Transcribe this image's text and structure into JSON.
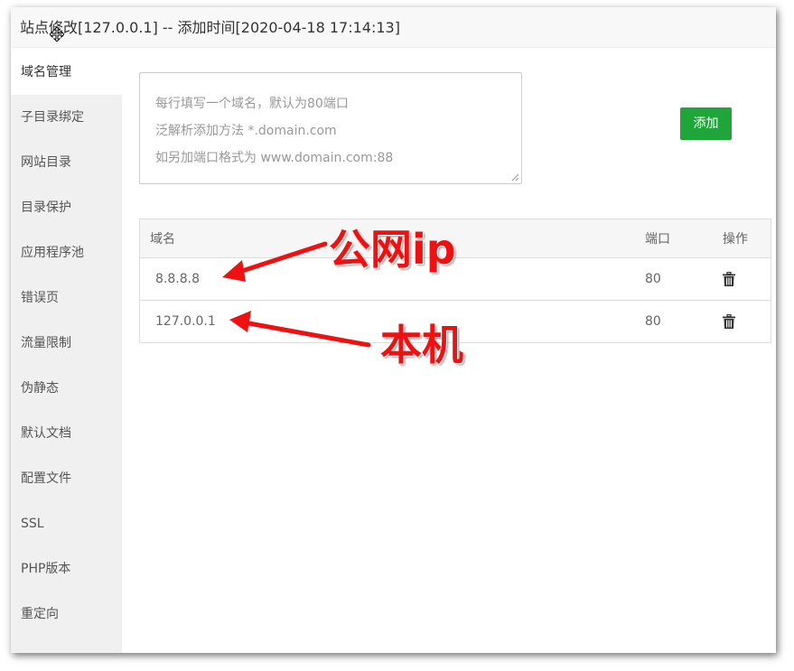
{
  "dialog": {
    "title": "站点修改[127.0.0.1] -- 添加时间[2020-04-18 17:14:13]"
  },
  "sidebar": {
    "items": [
      {
        "label": "域名管理"
      },
      {
        "label": "子目录绑定"
      },
      {
        "label": "网站目录"
      },
      {
        "label": "目录保护"
      },
      {
        "label": "应用程序池"
      },
      {
        "label": "错误页"
      },
      {
        "label": "流量限制"
      },
      {
        "label": "伪静态"
      },
      {
        "label": "默认文档"
      },
      {
        "label": "配置文件"
      },
      {
        "label": "SSL"
      },
      {
        "label": "PHP版本"
      },
      {
        "label": "重定向"
      }
    ],
    "active_index": 0
  },
  "domain_input": {
    "value": "",
    "placeholder_lines": [
      "每行填写一个域名，默认为80端口",
      "泛解析添加方法 *.domain.com",
      "如另加端口格式为 www.domain.com:88"
    ]
  },
  "add_button": {
    "label": "添加"
  },
  "table": {
    "columns": [
      "域名",
      "端口",
      "操作"
    ],
    "rows": [
      {
        "domain": "8.8.8.8",
        "port": "80"
      },
      {
        "domain": "127.0.0.1",
        "port": "80"
      }
    ],
    "row_action_icon": "trash-icon"
  },
  "annotations": {
    "public_ip": "公网ip",
    "local": "本机",
    "color": "#ee1111"
  },
  "colors": {
    "accent": "#20a53a",
    "sidebar_bg": "#f0f0f0"
  }
}
